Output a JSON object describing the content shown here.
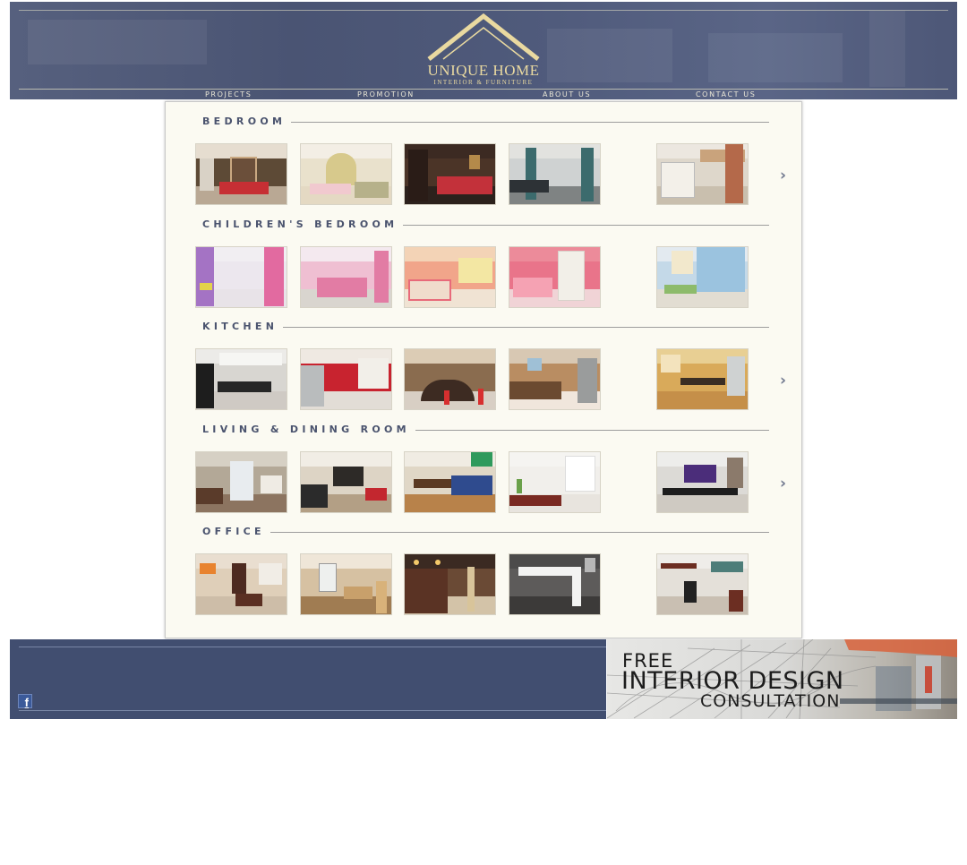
{
  "brand": {
    "name": "UNIQUE HOME",
    "tagline": "INTERIOR & FURNITURE",
    "gold": "#e9d9a0",
    "navy": "#414e70"
  },
  "nav": {
    "items": [
      {
        "label": "PROJECTS"
      },
      {
        "label": "PROMOTION"
      },
      {
        "label": "ABOUT US"
      },
      {
        "label": "CONTACT US"
      }
    ]
  },
  "sections": [
    {
      "title": "BEDROOM",
      "has_next_arrow": true
    },
    {
      "title": "CHILDREN'S BEDROOM",
      "has_next_arrow": false
    },
    {
      "title": "KITCHEN",
      "has_next_arrow": true
    },
    {
      "title": "LIVING & DINING ROOM",
      "has_next_arrow": true
    },
    {
      "title": "OFFICE",
      "has_next_arrow": false
    }
  ],
  "arrow_glyph": "›",
  "footer": {
    "social_icon": "facebook-icon",
    "social_glyph": "f"
  },
  "promo": {
    "line1": "FREE",
    "line2": "INTERIOR DESIGN",
    "line3": "CONSULTATION"
  }
}
